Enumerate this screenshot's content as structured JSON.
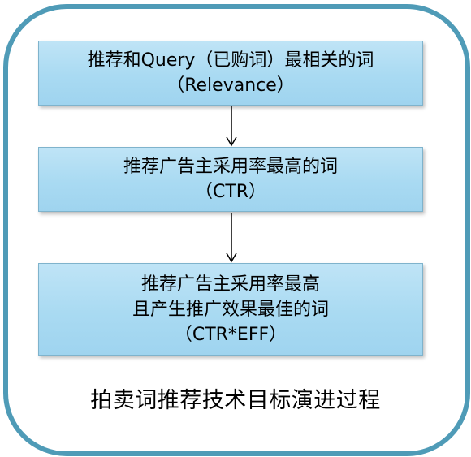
{
  "steps": [
    {
      "line1": "推荐和Query（已购词）最相关的词",
      "line2": "（Relevance）"
    },
    {
      "line1": "推荐广告主采用率最高的词",
      "line2": "（CTR）"
    },
    {
      "line1": "推荐广告主采用率最高",
      "line2": "且产生推广效果最佳的词",
      "line3": "（CTR*EFF）"
    }
  ],
  "caption": "拍卖词推荐技术目标演进过程",
  "colors": {
    "frame_border": "#4f9bb7",
    "box_fill": "#a9daf2",
    "box_border": "#7fb3cc",
    "arrow": "#000000"
  }
}
